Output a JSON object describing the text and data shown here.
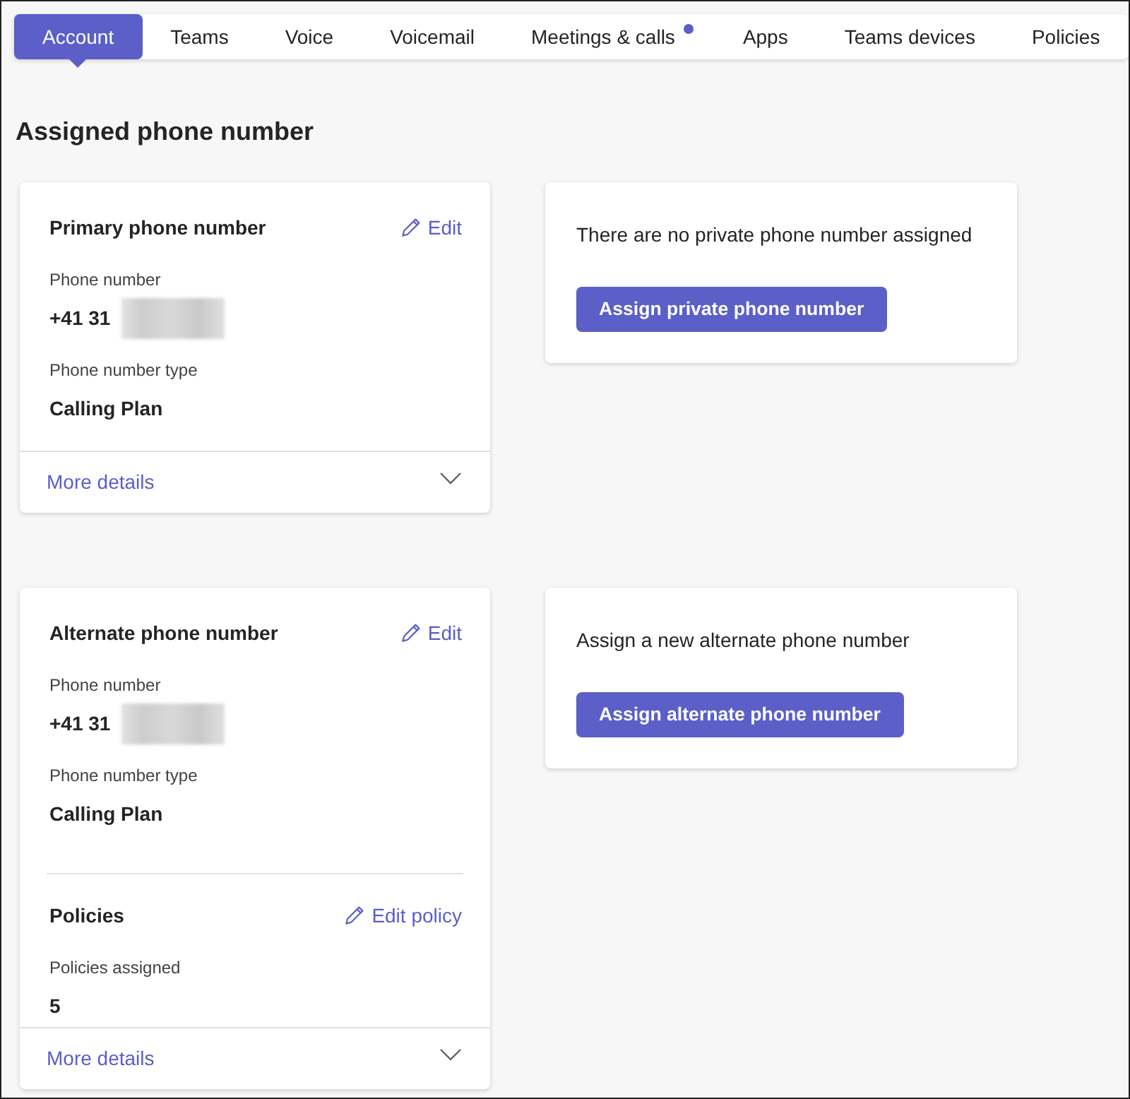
{
  "tabs": [
    {
      "label": "Account",
      "selected": true,
      "notification": false
    },
    {
      "label": "Teams",
      "selected": false,
      "notification": false
    },
    {
      "label": "Voice",
      "selected": false,
      "notification": false
    },
    {
      "label": "Voicemail",
      "selected": false,
      "notification": false
    },
    {
      "label": "Meetings & calls",
      "selected": false,
      "notification": true
    },
    {
      "label": "Apps",
      "selected": false,
      "notification": false
    },
    {
      "label": "Teams devices",
      "selected": false,
      "notification": false
    },
    {
      "label": "Policies",
      "selected": false,
      "notification": false
    }
  ],
  "heading": "Assigned phone number",
  "sections": [
    {
      "number_card": {
        "title": "Primary phone number",
        "edit_label": "Edit",
        "fields": [
          {
            "label": "Phone number",
            "value": "+41 31",
            "redacted": true
          },
          {
            "label": "Phone number type",
            "value": "Calling Plan",
            "redacted": false
          }
        ],
        "footer": {
          "label": "More details",
          "expanded": false
        }
      },
      "assign_card": {
        "message": "There are no private phone number assigned",
        "button": "Assign private phone number"
      }
    },
    {
      "number_card": {
        "title": "Alternate phone number",
        "edit_label": "Edit",
        "fields": [
          {
            "label": "Phone number",
            "value": "+41 31",
            "redacted": true
          },
          {
            "label": "Phone number type",
            "value": "Calling Plan",
            "redacted": false
          }
        ],
        "policies": {
          "title": "Policies",
          "edit_label": "Edit policy",
          "fields": [
            {
              "label": "Policies assigned",
              "value": "5",
              "redacted": false
            }
          ]
        },
        "footer": {
          "label": "More details",
          "expanded": false
        }
      },
      "assign_card": {
        "message": "Assign a new alternate phone number",
        "button": "Assign alternate phone number"
      }
    }
  ]
}
